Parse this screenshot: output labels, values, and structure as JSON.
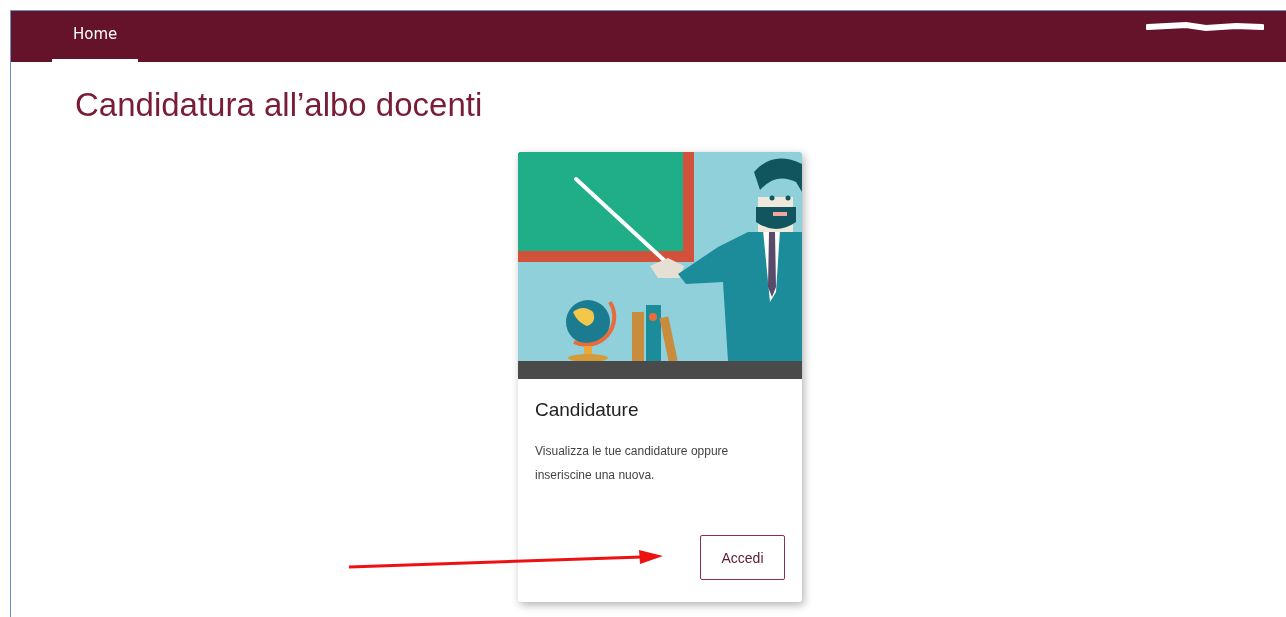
{
  "nav": {
    "tabs": [
      {
        "label": "Home",
        "selected": true
      }
    ]
  },
  "page_title": "Candidatura all’albo docenti",
  "card": {
    "title": "Candidature",
    "description": "Visualizza le tue candidature oppure inseriscine una nuova.",
    "button": "Accedi"
  }
}
